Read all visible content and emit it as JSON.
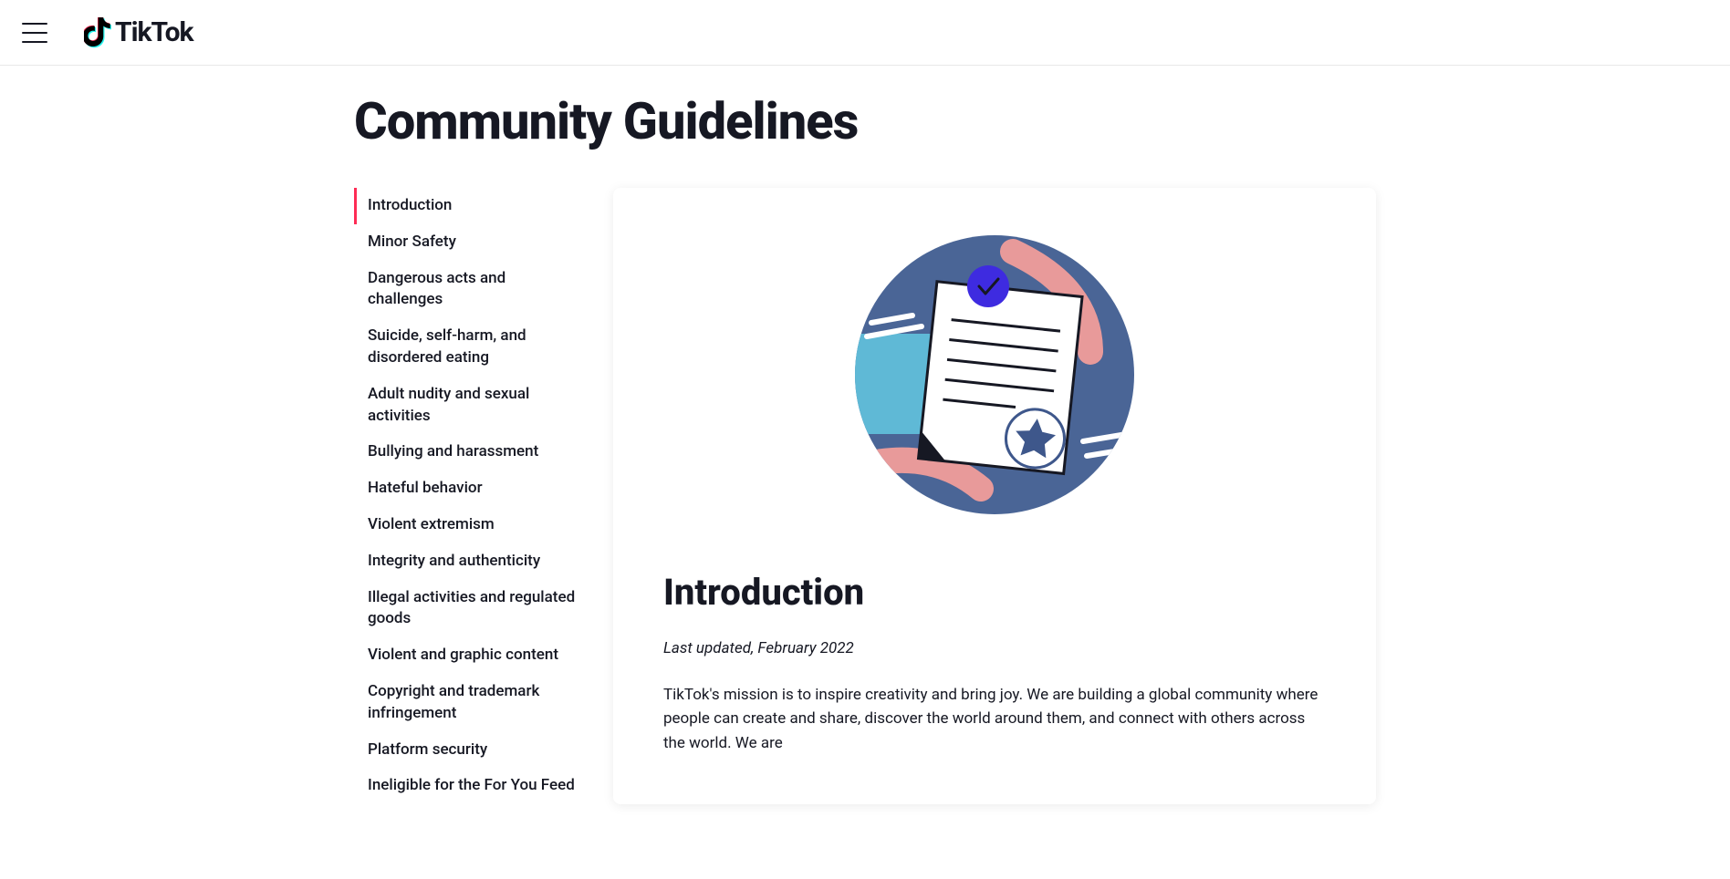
{
  "header": {
    "brand": "TikTok"
  },
  "page": {
    "title": "Community Guidelines"
  },
  "sidebar": {
    "items": [
      "Introduction",
      "Minor Safety",
      "Dangerous acts and challenges",
      "Suicide, self-harm, and disordered eating",
      "Adult nudity and sexual activities",
      "Bullying and harassment",
      "Hateful behavior",
      "Violent extremism",
      "Integrity and authenticity",
      "Illegal activities and regulated goods",
      "Violent and graphic content",
      "Copyright and trademark infringement",
      "Platform security",
      "Ineligible for the For You Feed"
    ]
  },
  "content": {
    "section_title": "Introduction",
    "last_updated": "Last updated, February 2022",
    "body": "TikTok's mission is to inspire creativity and bring joy. We are building a global community where people can create and share, discover the world around them, and connect with others across the world. We are"
  }
}
